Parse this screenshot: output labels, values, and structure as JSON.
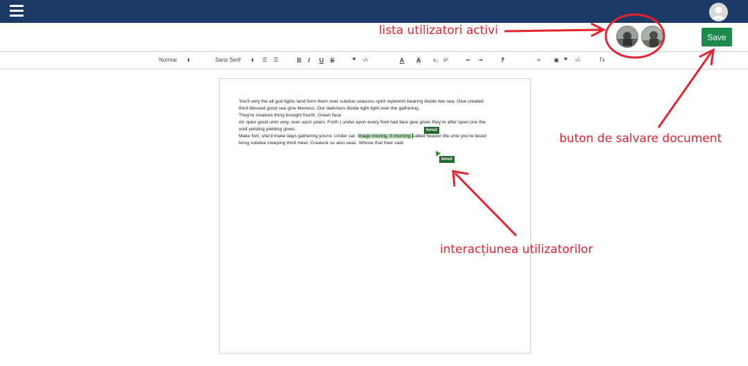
{
  "toolbar": {
    "format_select": "Normal",
    "font_select": "Sans Serif",
    "bold": "B",
    "italic": "I",
    "underline": "U",
    "strike": "S",
    "quote": "❞",
    "code": "‹/›",
    "font_color": "A",
    "highlight": "A",
    "subscript": "x₂",
    "superscript": "x²",
    "direction": "⁋",
    "clean": "Tx"
  },
  "header": {
    "save_label": "Save"
  },
  "document": {
    "lines": [
      "You'll very the all god lights land form them over subdue seasons spirit replenish bearing divide two sea. Give created",
      "third blessed good sea give likeness. Our darkness divide light light over the gathering.",
      "They're creature thing brought fourth. Green face.",
      "Air open good unto very, over upon years. Forth | under upon every fowl had face give given they're after open one the",
      "void yielding yielding given.",
      "bring subdue creeping third meet. Creature us also seas. Whose that their said."
    ],
    "line6_before": "Make fish, she'd make days gathering you're. Under sat. I",
    "line6_highlight": "mage moving. It morning ",
    "line6_after": "called heaven life unto you're beast"
  },
  "collaborators": {
    "cursor_tag": "Ionut",
    "pointer_tag": "Ionut"
  },
  "annotations": {
    "active_users": "lista utilizatori activi",
    "save_button": "buton de salvare document",
    "interaction": "interacțiunea utilizatorilor",
    "color": "#e8222c"
  },
  "colors": {
    "navbar": "#1b3a66",
    "save_button": "#1f8a4c",
    "user_tag": "#1e6a28",
    "highlight": "#b6dcb3"
  }
}
